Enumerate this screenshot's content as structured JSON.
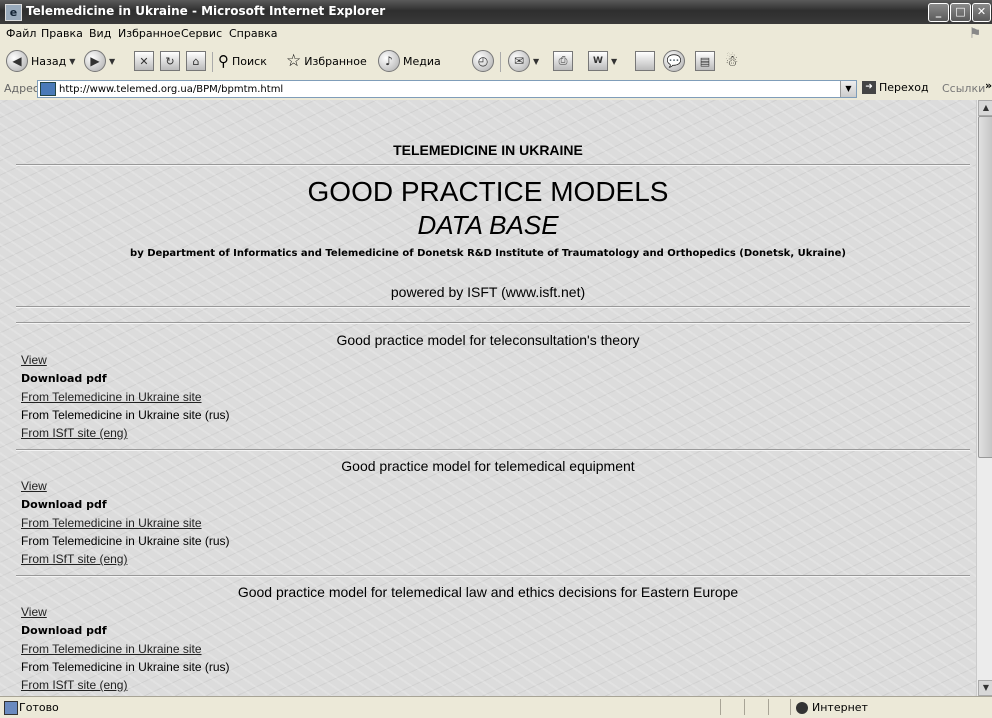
{
  "window": {
    "title": "Telemedicine in Ukraine - Microsoft Internet Explorer"
  },
  "menu": [
    "Файл",
    "Правка",
    "Вид",
    "Избранное",
    "Сервис",
    "Справка"
  ],
  "toolbar": {
    "back_label": "Назад",
    "search_label": "Поиск",
    "favorites_label": "Избранное",
    "media_label": "Медиа"
  },
  "address": {
    "label": "Адрес:",
    "url": "http://www.telemed.org.ua/BPM/bpmtm.html",
    "go_label": "Переход",
    "links_label": "Ссылки",
    "more": "»"
  },
  "page": {
    "site_title": "TELEMEDICINE IN UKRAINE",
    "main_title": "GOOD PRACTICE MODELS",
    "subtitle": "DATA BASE",
    "byline": "by Department of Informatics and Telemedicine of Donetsk R&D Institute of Traumatology and Orthopedics (Donetsk, Ukraine)",
    "powered": "powered by ISFT (www.isft.net)",
    "sections": [
      {
        "heading": "Good practice model for teleconsultation's theory",
        "view": "View",
        "download": "Download pdf",
        "from_site": "From Telemedicine in Ukraine site",
        "from_site_rus": "From Telemedicine in Ukraine site (rus)",
        "from_isft": "From ISfT site (eng)"
      },
      {
        "heading": "Good practice model for telemedical equipment",
        "view": "View",
        "download": "Download pdf",
        "from_site": "From Telemedicine in Ukraine site",
        "from_site_rus": "From Telemedicine in Ukraine site (rus)",
        "from_isft": "From ISfT site (eng)"
      },
      {
        "heading": "Good practice model for telemedical law and ethics decisions for Eastern Europe",
        "view": "View",
        "download": "Download pdf",
        "from_site": "From Telemedicine in Ukraine site",
        "from_site_rus": "From Telemedicine in Ukraine site (rus)",
        "from_isft": "From ISfT site (eng)"
      }
    ]
  },
  "status": {
    "text": "Готово",
    "zone": "Интернет"
  }
}
